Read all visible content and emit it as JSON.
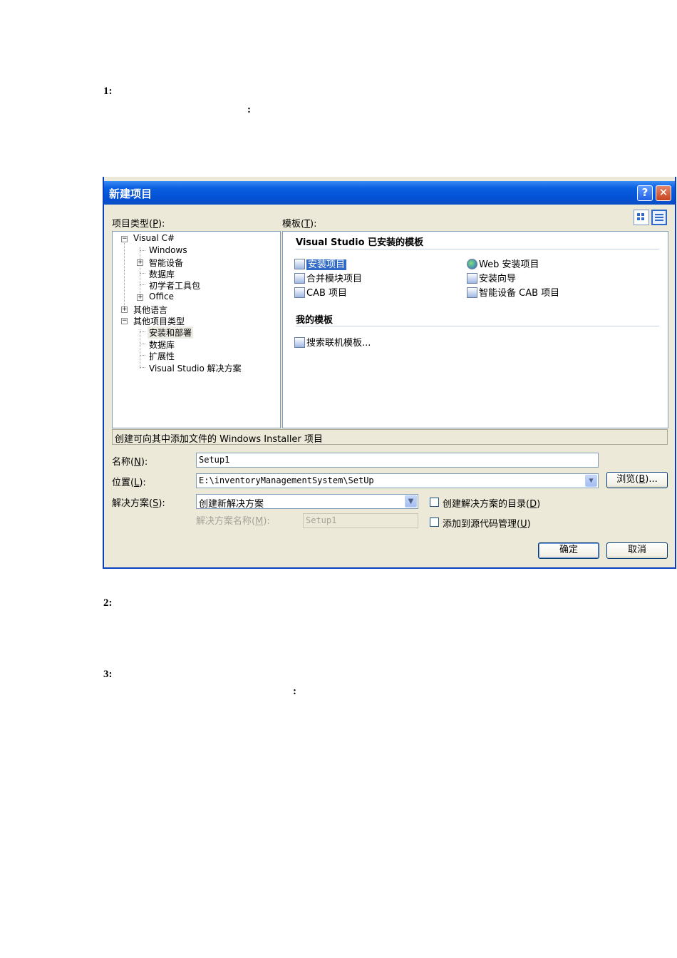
{
  "doc": {
    "step1": "1:",
    "step1_colon": ":",
    "step2": "2:",
    "step3": "3:",
    "step3_colon": ":"
  },
  "dialog": {
    "title": "新建项目",
    "help_glyph": "?",
    "close_glyph": "✕",
    "project_types_label": "项目类型",
    "project_types_key": "P",
    "templates_label": "模板",
    "templates_key": "T",
    "tree": [
      {
        "label": "Visual C#",
        "expander": "−"
      },
      {
        "label": "Windows"
      },
      {
        "label": "智能设备",
        "expander": "+"
      },
      {
        "label": "数据库"
      },
      {
        "label": "初学者工具包"
      },
      {
        "label": "Office",
        "expander": "+"
      },
      {
        "label": "其他语言",
        "expander": "+"
      },
      {
        "label": "其他项目类型",
        "expander": "−"
      },
      {
        "label": "安装和部署",
        "selected": true
      },
      {
        "label": "数据库"
      },
      {
        "label": "扩展性"
      },
      {
        "label": "Visual Studio 解决方案"
      }
    ],
    "installed_header": "Visual Studio 已安装的模板",
    "templates_left": [
      "安装项目",
      "合并模块项目",
      "CAB 项目"
    ],
    "templates_right": [
      "Web 安装项目",
      "安装向导",
      "智能设备 CAB 项目"
    ],
    "my_templates_header": "我的模板",
    "search_online": "搜索联机模板...",
    "description": "创建可向其中添加文件的 Windows Installer 项目",
    "name_label": "名称",
    "name_key": "N",
    "name_value": "Setup1",
    "location_label": "位置",
    "location_key": "L",
    "location_value": "E:\\inventoryManagementSystem\\SetUp",
    "browse_label": "浏览",
    "browse_key": "B",
    "solution_label": "解决方案",
    "solution_key": "S",
    "solution_value": "创建新解决方案",
    "solution_name_label": "解决方案名称",
    "solution_name_key": "M",
    "solution_name_value": "Setup1",
    "create_dir_label": "创建解决方案的目录",
    "create_dir_key": "D",
    "source_control_label": "添加到源代码管理",
    "source_control_key": "U",
    "ok_label": "确定",
    "cancel_label": "取消"
  }
}
